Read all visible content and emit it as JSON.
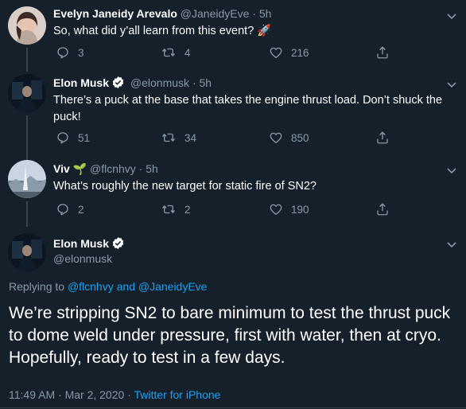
{
  "tweets": [
    {
      "name": "Evelyn Janeidy Arevalo",
      "handle": "@JaneidyEve",
      "sep": "·",
      "time": "5h",
      "text": "So, what did y’all learn from this event? 🚀",
      "replies": "3",
      "retweets": "4",
      "likes": "216"
    },
    {
      "name": "Elon Musk",
      "handle": "@elonmusk",
      "sep": "·",
      "time": "5h",
      "text": "There’s a puck at the base that takes the engine thrust load. Don’t shuck the puck!",
      "replies": "51",
      "retweets": "34",
      "likes": "850"
    },
    {
      "name": "Viv",
      "name_emoji": "🌱",
      "handle": "@flcnhvy",
      "sep": "·",
      "time": "5h",
      "text": "What’s roughly the new target for static fire of SN2?",
      "replies": "2",
      "retweets": "2",
      "likes": "190"
    }
  ],
  "main_tweet": {
    "name": "Elon Musk",
    "handle": "@elonmusk",
    "replying_prefix": "Replying to",
    "replying_user1": "@flcnhvy",
    "replying_and": "and",
    "replying_user2": "@JaneidyEve",
    "text": "We’re stripping SN2 to bare minimum to test the thrust puck to dome weld under pressure, first with water, then at cryo. Hopefully, ready to test in a few days.",
    "time": "11:49 AM",
    "sep": "·",
    "date": "Mar 2, 2020",
    "sep2": "·",
    "client": "Twitter for iPhone"
  },
  "icons": {
    "reply": "reply-icon",
    "retweet": "retweet-icon",
    "like": "heart-icon",
    "share": "share-icon",
    "caret": "chevron-down-icon",
    "verified": "verified-badge-icon"
  },
  "colors": {
    "background": "#15202b",
    "text": "#ffffff",
    "muted": "#8899a6",
    "link": "#1da1f2",
    "divider": "#38444d"
  }
}
